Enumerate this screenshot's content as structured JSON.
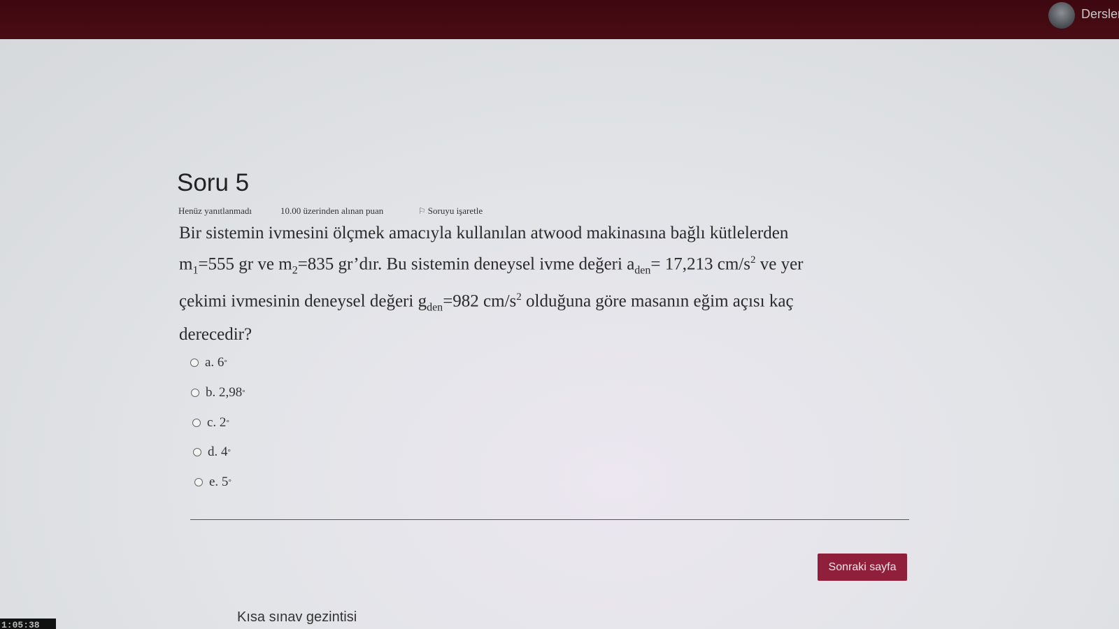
{
  "header": {
    "user_label": "Dersler"
  },
  "question": {
    "title": "Soru 5",
    "status": "Henüz yanıtlanmadı",
    "points": "10.00 üzerinden alınan puan",
    "flag_label": "Soruyu işaretle",
    "text": {
      "line1": "Bir sistemin ivmesini ölçmek amacıyla kullanılan atwood makinasına bağlı kütlelerden",
      "m1_label": "m",
      "m1_sub": "1",
      "m1_value": "=555 gr ve ",
      "m2_label": "m",
      "m2_sub": "2",
      "m2_value": "=835 gr’dır. Bu sistemin deneysel ivme değeri ",
      "a_label": "a",
      "a_sub": "den",
      "a_value": "= 17,213 cm/s",
      "a_exp": "2",
      "a_tail": " ve yer",
      "line3_start": "çekimi ivmesinin deneysel değeri ",
      "g_label": "g",
      "g_sub": "den",
      "g_value": "=982 cm/s",
      "g_exp": "2",
      "g_tail": " olduğuna göre masanın eğim açısı kaç",
      "line4": "derecedir?"
    },
    "options": [
      {
        "label": "a. 6",
        "degree": "°"
      },
      {
        "label": "b. 2,98",
        "degree": "°"
      },
      {
        "label": "c. 2",
        "degree": "°"
      },
      {
        "label": "d. 4",
        "degree": "°"
      },
      {
        "label": "e. 5",
        "degree": "°"
      }
    ]
  },
  "footer": {
    "next_button": "Sonraki sayfa",
    "nav_link": "Kısa sınav gezintisi",
    "timer": "1:05:38"
  }
}
